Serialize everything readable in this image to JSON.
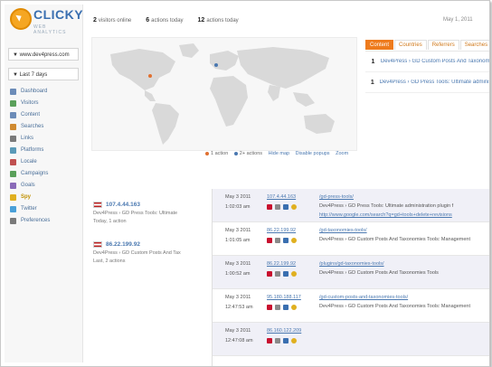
{
  "brand": {
    "name": "CLICKY",
    "tagline": "WEB ANALYTICS"
  },
  "sidebar": {
    "site": "▼ www.dev4press.com",
    "range": "▼ Last 7 days",
    "items": [
      {
        "label": "Dashboard",
        "color": "#6c8cb8"
      },
      {
        "label": "Visitors",
        "color": "#5aa05a"
      },
      {
        "label": "Content",
        "color": "#6c8cb8"
      },
      {
        "label": "Searches",
        "color": "#d08a30"
      },
      {
        "label": "Links",
        "color": "#7a7a7a"
      },
      {
        "label": "Platforms",
        "color": "#5a9ab8"
      },
      {
        "label": "Locale",
        "color": "#c05050"
      },
      {
        "label": "Campaigns",
        "color": "#5aa05a"
      },
      {
        "label": "Goals",
        "color": "#8a6ab8"
      },
      {
        "label": "Spy",
        "color": "#e0b020"
      },
      {
        "label": "Twitter",
        "color": "#4aa0d8"
      },
      {
        "label": "Preferences",
        "color": "#7a7a7a"
      }
    ]
  },
  "stats": [
    {
      "num": "2",
      "label": "visitors online"
    },
    {
      "num": "6",
      "label": "actions today"
    },
    {
      "num": "12",
      "label": "actions today"
    }
  ],
  "dateinfo": "May 1, 2011",
  "map": {
    "legend": {
      "one": "1 action",
      "two": "2+ actions",
      "hide": "Hide map",
      "disable": "Disable popups",
      "zoom": "Zoom"
    }
  },
  "tabs": [
    "Content",
    "Countries",
    "Referrers",
    "Searches"
  ],
  "top_content": [
    {
      "count": "1",
      "title": "Dev4Press › GD Custom Posts And Taxonomies"
    },
    {
      "count": "1",
      "title": "Dev4Press › GD Press Tools: Ultimate administration"
    }
  ],
  "visitors": [
    {
      "ip": "107.4.44.163",
      "line1": "Dev4Press › GD Press Tools: Ultimate",
      "line2": "Today, 1 action"
    },
    {
      "ip": "86.22.199.92",
      "line1": "Dev4Press › GD Custom Posts And Tax",
      "line2": "Last, 2 actions"
    }
  ],
  "feed": [
    {
      "date": "May 3 2011",
      "time": "1:02:03 am",
      "ip": "107.4.44.163",
      "url": "/gd-press-tools/",
      "title": "Dev4Press › GD Press Tools: Ultimate administration plugin f",
      "ref": "http://www.google.com/search?q=gd+tools+delete+revisions",
      "alt": true
    },
    {
      "date": "May 3 2011",
      "time": "1:01:05 am",
      "ip": "86.22.199.92",
      "url": "/gd-taxonomies-tools/",
      "title": "Dev4Press › GD Custom Posts And Taxonomies Tools: Management",
      "ref": "",
      "alt": false
    },
    {
      "date": "May 3 2011",
      "time": "1:00:52 am",
      "ip": "86.22.199.92",
      "url": "/plugins/gd-taxonomies-tools/",
      "title": "Dev4Press › GD Custom Posts And Taxonomies Tools",
      "ref": "",
      "alt": true
    },
    {
      "date": "May 3 2011",
      "time": "12:47:53 am",
      "ip": "95.180.188.117",
      "url": "/gd-custom-posts-and-taxonomies-tools/",
      "title": "Dev4Press › GD Custom Posts And Taxonomies Tools: Management",
      "ref": "",
      "alt": false
    },
    {
      "date": "May 3 2011",
      "time": "12:47:08 am",
      "ip": "86.160.122.209",
      "url": "",
      "title": "",
      "ref": "",
      "alt": true
    }
  ]
}
